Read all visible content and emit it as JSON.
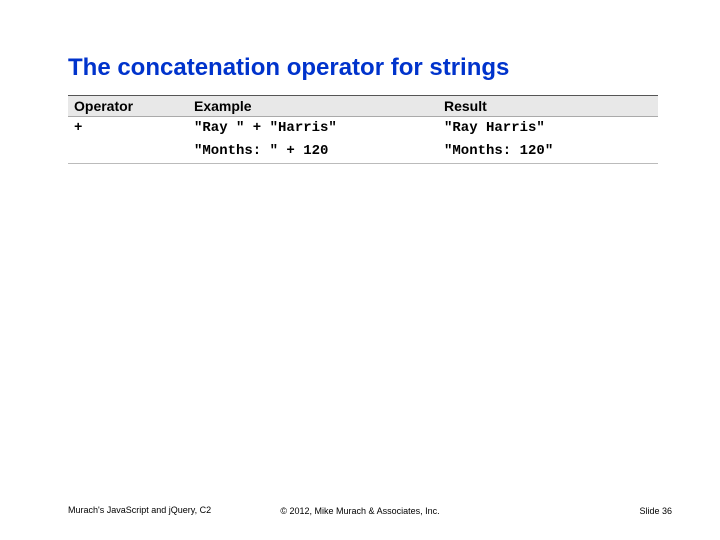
{
  "title": "The concatenation operator for strings",
  "table": {
    "headers": {
      "operator": "Operator",
      "example": "Example",
      "result": "Result"
    },
    "rows": [
      {
        "operator": "+",
        "example": "\"Ray \" + \"Harris\"",
        "result": "\"Ray Harris\""
      },
      {
        "operator": "",
        "example": "\"Months: \" + 120",
        "result": "\"Months: 120\""
      }
    ]
  },
  "footer": {
    "left": "Murach's JavaScript and jQuery, C2",
    "center": "© 2012, Mike Murach & Associates, Inc.",
    "right": "Slide 36"
  }
}
